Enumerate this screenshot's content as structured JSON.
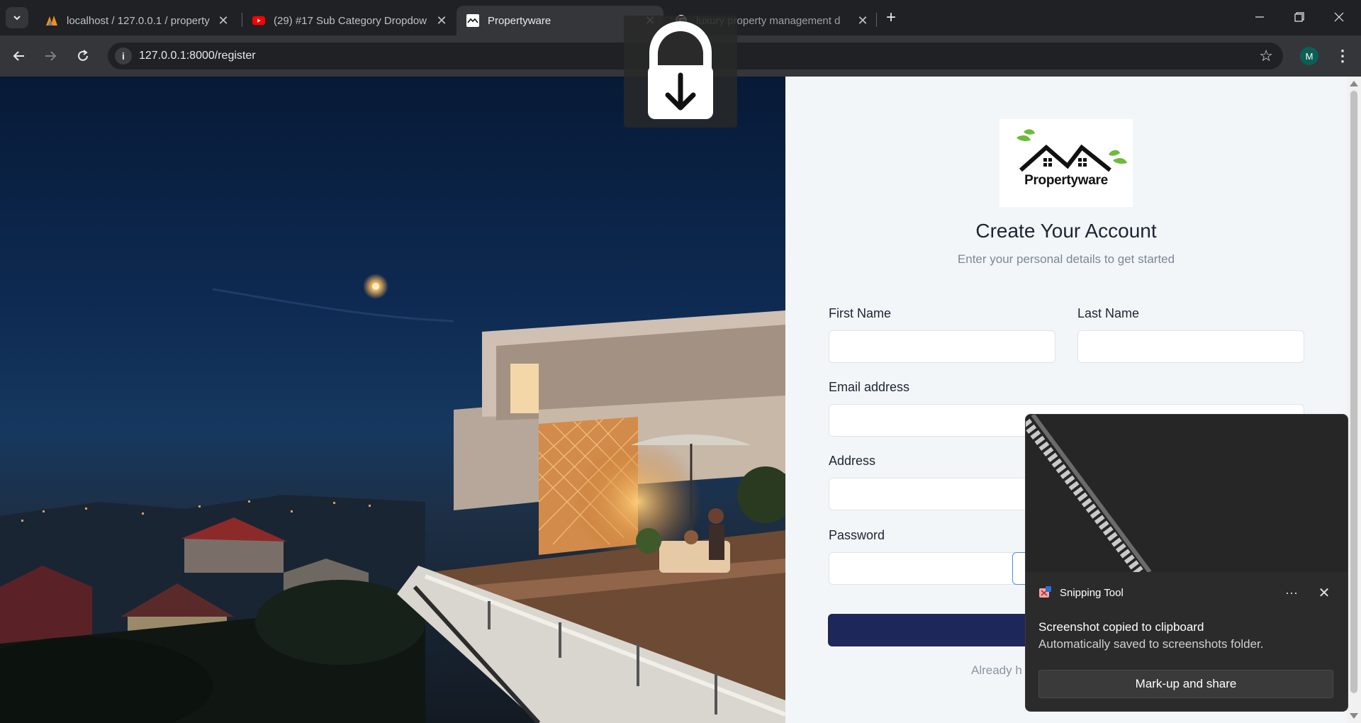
{
  "browser": {
    "tabs": [
      {
        "title": "localhost / 127.0.0.1 / property",
        "icon": "phpmyadmin-icon"
      },
      {
        "title": "(29) #17 Sub Category Dropdow",
        "icon": "youtube-icon"
      },
      {
        "title": "Propertyware",
        "icon": "propertyware-favicon",
        "active": true
      },
      {
        "title": "luxury property management d",
        "icon": "google-icon"
      }
    ],
    "url": "127.0.0.1:8000/register",
    "profile_initial": "M"
  },
  "page": {
    "logo_text": "Propertyware",
    "heading": "Create Your Account",
    "subheading": "Enter your personal details to get started",
    "fields": {
      "first_name": "First Name",
      "last_name": "Last Name",
      "email": "Email address",
      "address": "Address",
      "password": "Password"
    },
    "already_text": "Already h"
  },
  "toast": {
    "app_name": "Snipping Tool",
    "title": "Screenshot copied to clipboard",
    "body": "Automatically saved to screenshots folder.",
    "button": "Mark-up and share"
  },
  "colors": {
    "primary_button": "#1e2759",
    "page_bg": "#f3f6f9",
    "browser_dark": "#202124"
  }
}
